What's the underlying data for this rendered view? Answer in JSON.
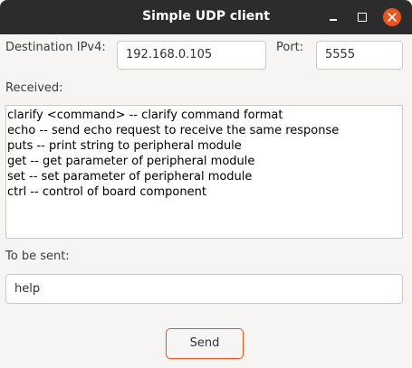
{
  "window": {
    "title": "Simple UDP client"
  },
  "destination": {
    "label": "Destination IPv4:",
    "value": "192.168.0.105"
  },
  "port": {
    "label": "Port:",
    "value": "5555"
  },
  "received": {
    "label": "Received:",
    "lines": [
      "clarify <command> -- clarify command format",
      "echo -- send echo request to receive the same response",
      "puts -- print string to peripheral module",
      "get -- get parameter of peripheral module",
      "set -- set parameter of peripheral module",
      "ctrl -- control of board component"
    ]
  },
  "to_send": {
    "label": "To be sent:",
    "value": "help"
  },
  "send_button": {
    "label": "Send"
  },
  "colors": {
    "titlebar": "#2c2c2c",
    "accent": "#e95420",
    "background": "#f6f5f4"
  },
  "icons": {
    "minimize": "minimize-icon",
    "maximize": "maximize-icon",
    "close": "close-icon"
  }
}
